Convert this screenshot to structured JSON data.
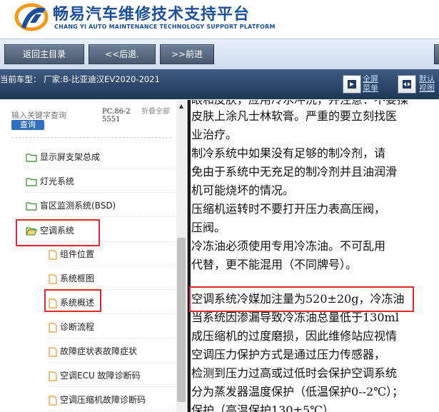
{
  "header": {
    "title": "畅易汽车维修技术支持平台",
    "subtitle": "CHANG YI AUTO MAINTENANCE TECHNOLOGY SUPPORT PLATFORM"
  },
  "nav": {
    "back_label": "返回主目录",
    "prev_label": "<<后退.",
    "next_label": ">>前进"
  },
  "infobar": {
    "vehicle_text": "当前车型： 厂家:B-比亚迪汉EV2020-2021",
    "fullscreen_label_1": "全屏",
    "fullscreen_label_2": "菜单",
    "default_label_1": "默认",
    "default_label_2": "视图"
  },
  "sidebar": {
    "search_placeholder": "输入关键字查询",
    "search_button": "查询",
    "code": "PC.86-25551",
    "collapse_all": "折叠全部",
    "items": [
      {
        "label": "显示屏支架总成",
        "type": "folder"
      },
      {
        "label": "灯光系统",
        "type": "folder"
      },
      {
        "label": "盲区监测系统(BSD)",
        "type": "folder"
      },
      {
        "label": "空调系统",
        "type": "folder-open"
      },
      {
        "label": "组件位置",
        "type": "doc"
      },
      {
        "label": "系统框图",
        "type": "doc"
      },
      {
        "label": "系统概述",
        "type": "doc"
      },
      {
        "label": "诊断流程",
        "type": "doc"
      },
      {
        "label": "故障症状表故障症状",
        "type": "doc"
      },
      {
        "label": "空调ECU 故障诊断码",
        "type": "doc"
      },
      {
        "label": "空调压缩机故障诊断码",
        "type": "doc"
      }
    ]
  },
  "content": {
    "lines": [
      "眼和皮肤，应用冷水冲洗，并注意：不要揉",
      "皮肤上涂凡士林软膏。严重的要立刻找医",
      "业治疗。",
      " 制冷系统中如果没有足够的制冷剂，请",
      "免由于系统中无充足的制冷剂并且油润滑",
      "机可能烧坏的情况。",
      " 压缩机运转时不要打开压力表高压阀，",
      "压阀。",
      " 冷冻油必须使用专用冷冻油。不可乱用",
      "代替，更不能混用（不同牌号）。",
      " 空调系统冷媒加注量为520±20g，冷冻油",
      "当系统因渗漏导致冷冻油总量低于130ml",
      "成压缩机的过度磨损，因此维修站应视情",
      " 空调压力保护方式是通过压力传感器，",
      "检测到压力过高或过低时会保护空调系统",
      "分为蒸发器温度保护（低温保护0--2℃）；",
      "保护（高温保护130±5℃）"
    ]
  },
  "colors": {
    "brand": "#1b4f9c",
    "highlight": "#e0282c",
    "infobar": "#2a4468"
  }
}
